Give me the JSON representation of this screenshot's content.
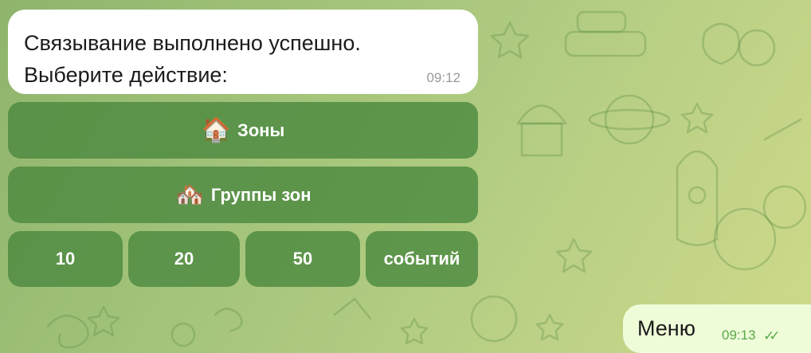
{
  "messages": {
    "incoming": {
      "line1": "Связывание выполнено успешно.",
      "line2": "Выберите действие:",
      "time": "09:12"
    },
    "outgoing": {
      "text": "Меню",
      "time": "09:13",
      "status_icon": "double-check-icon"
    }
  },
  "keyboard": {
    "zones": {
      "emoji": "🏠",
      "label": "Зоны"
    },
    "zone_groups": {
      "emoji": "🏘️",
      "label": "Группы зон"
    },
    "count_10": "10",
    "count_20": "20",
    "count_50": "50",
    "events": "событий"
  },
  "colors": {
    "button_bg": "#4c8a40",
    "outgoing_bubble": "#eefcd8",
    "incoming_bubble": "#ffffff",
    "outgoing_time": "#5aa84b"
  }
}
